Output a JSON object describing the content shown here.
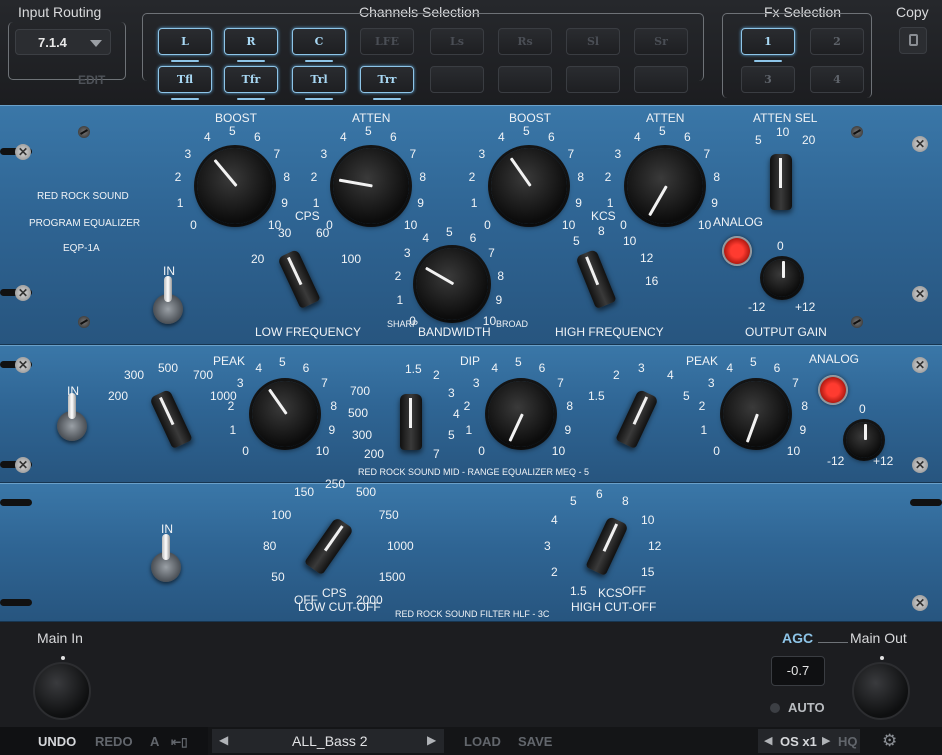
{
  "header": {
    "input_routing": "Input Routing",
    "routing_value": "7.1.4",
    "edit": "EDIT",
    "channels_selection": "Channels Selection",
    "fx_selection": "Fx Selection",
    "copy": "Copy"
  },
  "channels": [
    "L",
    "R",
    "C",
    "LFE",
    "Ls",
    "Rs",
    "Sl",
    "Sr",
    "Tfl",
    "Tfr",
    "Trl",
    "Trr"
  ],
  "fx_slots": [
    "1",
    "2",
    "3",
    "4"
  ],
  "eqp": {
    "boost": "BOOST",
    "atten": "ATTEN",
    "atten_sel": "ATTEN SEL",
    "cps": "CPS",
    "kcs": "KCS",
    "analog": "ANALOG",
    "in": "IN",
    "low_freq": "LOW FREQUENCY",
    "bandwidth": "BANDWIDTH",
    "high_freq": "HIGH FREQUENCY",
    "output_gain": "OUTPUT GAIN",
    "sharp": "SHARP",
    "broad": "BROAD",
    "brand1": "RED ROCK SOUND",
    "brand2": "PROGRAM EQUALIZER",
    "brand3": "EQP-1A",
    "cps_vals": [
      "20",
      "30",
      "60",
      "100"
    ],
    "kcs_vals": [
      "5",
      "8",
      "10",
      "12",
      "16"
    ],
    "atten_sel_vals": [
      "5",
      "10",
      "20"
    ],
    "gain_vals": [
      "0",
      "-12",
      "+12"
    ],
    "dial": [
      "0",
      "1",
      "2",
      "3",
      "4",
      "5",
      "6",
      "7",
      "8",
      "9",
      "10"
    ]
  },
  "meq": {
    "peak": "PEAK",
    "dip": "DIP",
    "analog": "ANALOG",
    "in": "IN",
    "brand": "RED ROCK SOUND     MID - RANGE EQUALIZER     MEQ - 5",
    "low_vals": [
      "200",
      "300",
      "500",
      "700",
      "1000"
    ],
    "dip_vals": [
      "200",
      "300",
      "500",
      "700",
      "1",
      "1.5",
      "2",
      "3",
      "4",
      "5",
      "7"
    ],
    "high_vals": [
      "1.5",
      "2",
      "3",
      "4",
      "5"
    ],
    "gain_vals": [
      "0",
      "-12",
      "+12"
    ]
  },
  "hlf": {
    "in": "IN",
    "cps": "CPS",
    "low_cut": "LOW CUT-OFF",
    "kcs": "KCS",
    "high_cut": "HIGH CUT-OFF",
    "brand": "RED ROCK SOUND    FILTER    HLF - 3C",
    "low_vals": [
      "OFF",
      "50",
      "80",
      "100",
      "150",
      "250",
      "500",
      "750",
      "1000",
      "1500",
      "2000"
    ],
    "high_vals": [
      "1.5",
      "2",
      "3",
      "4",
      "5",
      "6",
      "8",
      "10",
      "12",
      "15",
      "OFF"
    ]
  },
  "footer": {
    "main_in": "Main In",
    "agc": "AGC",
    "agc_value": "-0.7",
    "main_out": "Main Out",
    "auto": "AUTO",
    "undo": "UNDO",
    "redo": "REDO",
    "a": "A",
    "preset": "ALL_Bass 2",
    "load": "LOAD",
    "save": "SAVE",
    "os": "OS x1",
    "hq": "HQ"
  },
  "colors": {
    "panel": "#2f6594",
    "accent": "#8ec5e8",
    "lamp": "#ff3b30"
  }
}
